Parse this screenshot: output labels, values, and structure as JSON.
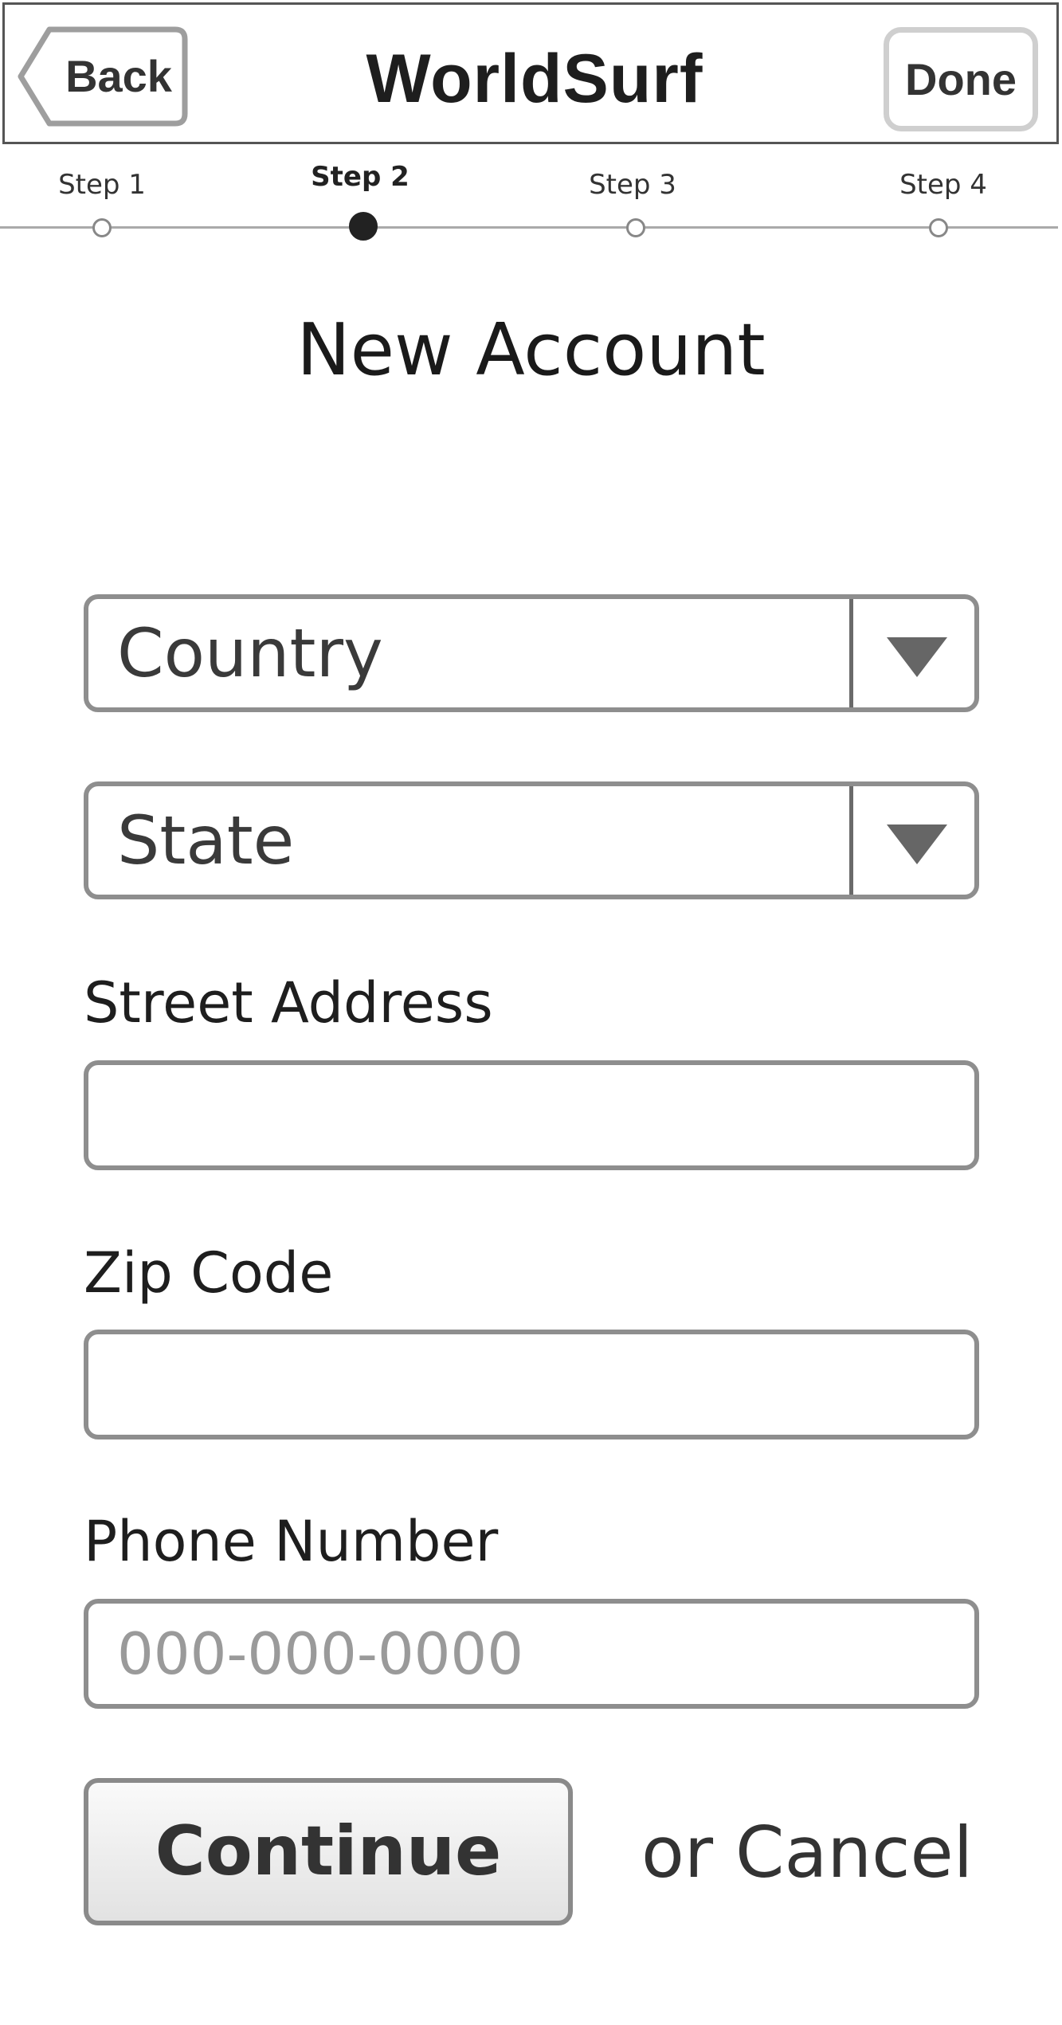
{
  "header": {
    "back_label": "Back",
    "title": "WorldSurf",
    "done_label": "Done"
  },
  "stepper": {
    "steps": [
      {
        "label": "Step 1",
        "active": false
      },
      {
        "label": "Step 2",
        "active": true
      },
      {
        "label": "Step 3",
        "active": false
      },
      {
        "label": "Step 4",
        "active": false
      }
    ]
  },
  "page_title": "New Account",
  "form": {
    "country_select": {
      "value": "Country",
      "icon": "triangle-down-icon"
    },
    "state_select": {
      "value": "State",
      "icon": "triangle-down-icon"
    },
    "street_address": {
      "label": "Street Address",
      "value": "",
      "placeholder": ""
    },
    "zip_code": {
      "label": "Zip Code",
      "value": "",
      "placeholder": ""
    },
    "phone_number": {
      "label": "Phone Number",
      "value": "",
      "placeholder": "000-000-0000"
    }
  },
  "actions": {
    "continue_label": "Continue",
    "cancel_label": "or Cancel"
  },
  "colors": {
    "border": "#8e8e8e",
    "text": "#222222",
    "placeholder": "#9a9a9a",
    "active_step": "#222222"
  }
}
